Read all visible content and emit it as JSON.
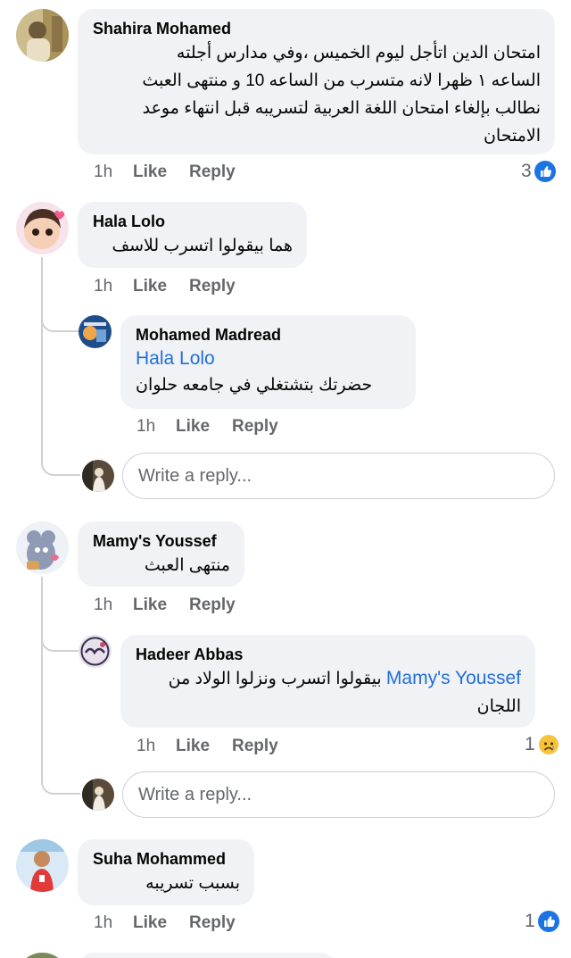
{
  "comments": [
    {
      "author": "Shahira Mohamed",
      "lines": [
        "امتحان الدين اتأجل ليوم الخميس ،وفي مدارس أجلته",
        "الساعه ١ ظهرا  لانه متسرب من الساعه 10 و منتهى العبث",
        "نطالب بإلغاء امتحان اللغة العربية لتسريبه قبل انتهاء موعد",
        "الامتحان"
      ],
      "time": "1h",
      "like": "Like",
      "reply": "Reply",
      "reaction_count": "3",
      "reaction_icon": "like-icon"
    },
    {
      "author": "Hala Lolo",
      "lines": [
        "هما بيقولوا اتسرب للاسف"
      ],
      "time": "1h",
      "like": "Like",
      "reply": "Reply",
      "replies": [
        {
          "author": "Mohamed Madread",
          "mention": "Hala Lolo",
          "lines": [
            "حضرتك بتشتغلي في جامعه حلوان"
          ],
          "time": "1h",
          "like": "Like",
          "reply": "Reply"
        }
      ],
      "reply_placeholder": "Write a reply..."
    },
    {
      "author": "Mamy's Youssef",
      "lines": [
        "منتهى العبث"
      ],
      "time": "1h",
      "like": "Like",
      "reply": "Reply",
      "replies": [
        {
          "author": "Hadeer Abbas",
          "mention": "Mamy's Youssef",
          "line1": "بيقولوا اتسرب ونزلوا الولاد من",
          "line2": "اللجان",
          "time": "1h",
          "like": "Like",
          "reply": "Reply",
          "reaction_count": "1",
          "reaction_icon": "sad-face-icon"
        }
      ],
      "reply_placeholder": "Write a reply..."
    },
    {
      "author": "Suha Mohammed",
      "lines": [
        "بسبب تسريبه"
      ],
      "time": "1h",
      "like": "Like",
      "reply": "Reply",
      "reaction_count": "1",
      "reaction_icon": "like-icon"
    }
  ],
  "colors": {
    "link": "#216fdb",
    "like_blue": "#1b74e4",
    "bubble": "#f0f2f5",
    "meta": "#65676b"
  }
}
